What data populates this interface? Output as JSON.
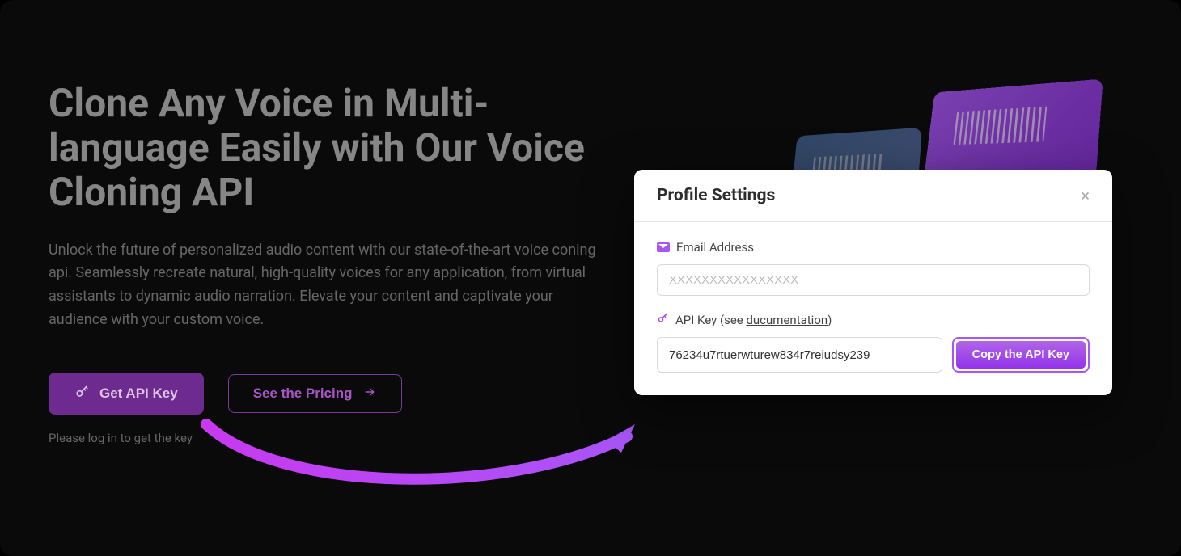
{
  "hero": {
    "title": "Clone Any Voice in Multi-language Easily with Our Voice Cloning API",
    "description": "Unlock the future of personalized audio content with our state-of-the-art voice coning api. Seamlessly recreate natural, high-quality voices for any application, from virtual assistants to dynamic audio narration. Elevate your content and captivate your audience with your custom voice."
  },
  "buttons": {
    "get_api_key": "Get API Key",
    "see_pricing": "See the Pricing"
  },
  "login_hint": "Please log in to get the key",
  "modal": {
    "title": "Profile Settings",
    "email_label": "Email Address",
    "email_placeholder": "XXXXXXXXXXXXXXXX",
    "api_key_label_prefix": "API Key (see ",
    "api_key_doc_link": "ducumentation",
    "api_key_label_suffix": ")",
    "api_key_value": "76234u7rtuerwturew834r7reiudsy239",
    "copy_button": "Copy the API Key"
  }
}
